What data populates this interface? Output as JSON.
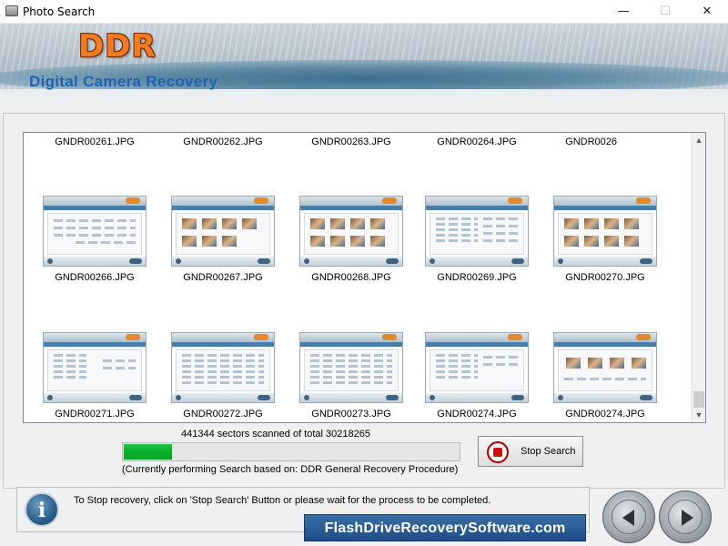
{
  "window": {
    "title": "Photo Search",
    "minimize": "—",
    "maximize": "☐",
    "close": "✕"
  },
  "header": {
    "logo": "DDR",
    "subtitle": "Digital Camera Recovery"
  },
  "gallery": {
    "top_row": [
      "GNDR00261.JPG",
      "GNDR00262.JPG",
      "GNDR00263.JPG",
      "GNDR00264.JPG",
      "GNDR0026"
    ],
    "row2": [
      "GNDR00266.JPG",
      "GNDR00267.JPG",
      "GNDR00268.JPG",
      "GNDR00269.JPG",
      "GNDR00270.JPG"
    ],
    "row3": [
      "GNDR00271.JPG",
      "GNDR00272.JPG",
      "GNDR00273.JPG",
      "GNDR00274.JPG",
      "GNDR00274.JPG"
    ]
  },
  "scan": {
    "progress_text": "441344 sectors scanned of total 30218265",
    "sectors_scanned": 441344,
    "sectors_total": 30218265,
    "progress_fraction": 0.145,
    "status": "(Currently performing Search based on:  DDR General Recovery Procedure)",
    "stop_label": "Stop Search"
  },
  "footer": {
    "info_icon": "i",
    "info": "To Stop recovery, click on 'Stop Search' Button or please wait for the process to be completed.",
    "site": "FlashDriveRecoverySoftware.com"
  },
  "colors": {
    "accent": "#1f62b4",
    "logo": "#f07a26",
    "progress": "#06b025",
    "stop": "#d01010"
  }
}
